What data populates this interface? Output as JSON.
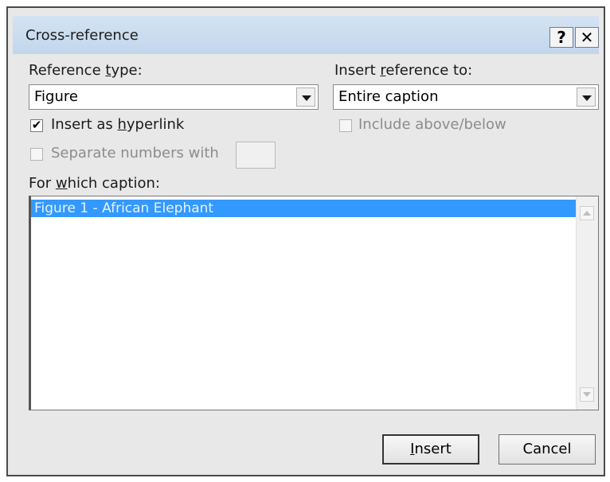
{
  "dialog": {
    "title": "Cross-reference",
    "help_label": "?",
    "close_label": "✕"
  },
  "reference_type": {
    "label_pre": "Reference ",
    "label_key": "t",
    "label_post": "ype:",
    "value": "Figure"
  },
  "insert_reference_to": {
    "label_pre": "Insert ",
    "label_key": "r",
    "label_post": "eference to:",
    "value": "Entire caption"
  },
  "insert_as_hyperlink": {
    "label_pre": "Insert as ",
    "label_key": "h",
    "label_post": "yperlink",
    "checked": true,
    "check_glyph": "✔"
  },
  "include_above_below": {
    "label": "Include above/below",
    "checked": false,
    "enabled": false
  },
  "separate_numbers": {
    "label": "Separate numbers with",
    "checked": false,
    "enabled": false,
    "value": ""
  },
  "caption_list": {
    "label_pre": "For ",
    "label_key": "w",
    "label_post": "hich caption:",
    "items": [
      "Figure 1 - African Elephant"
    ],
    "selected_index": 0
  },
  "buttons": {
    "insert_key": "I",
    "insert_rest": "nsert",
    "cancel": "Cancel"
  },
  "colors": {
    "selection": "#3399ff",
    "titlebar": "#c8daef",
    "dialog_bg": "#e8e8e8"
  }
}
